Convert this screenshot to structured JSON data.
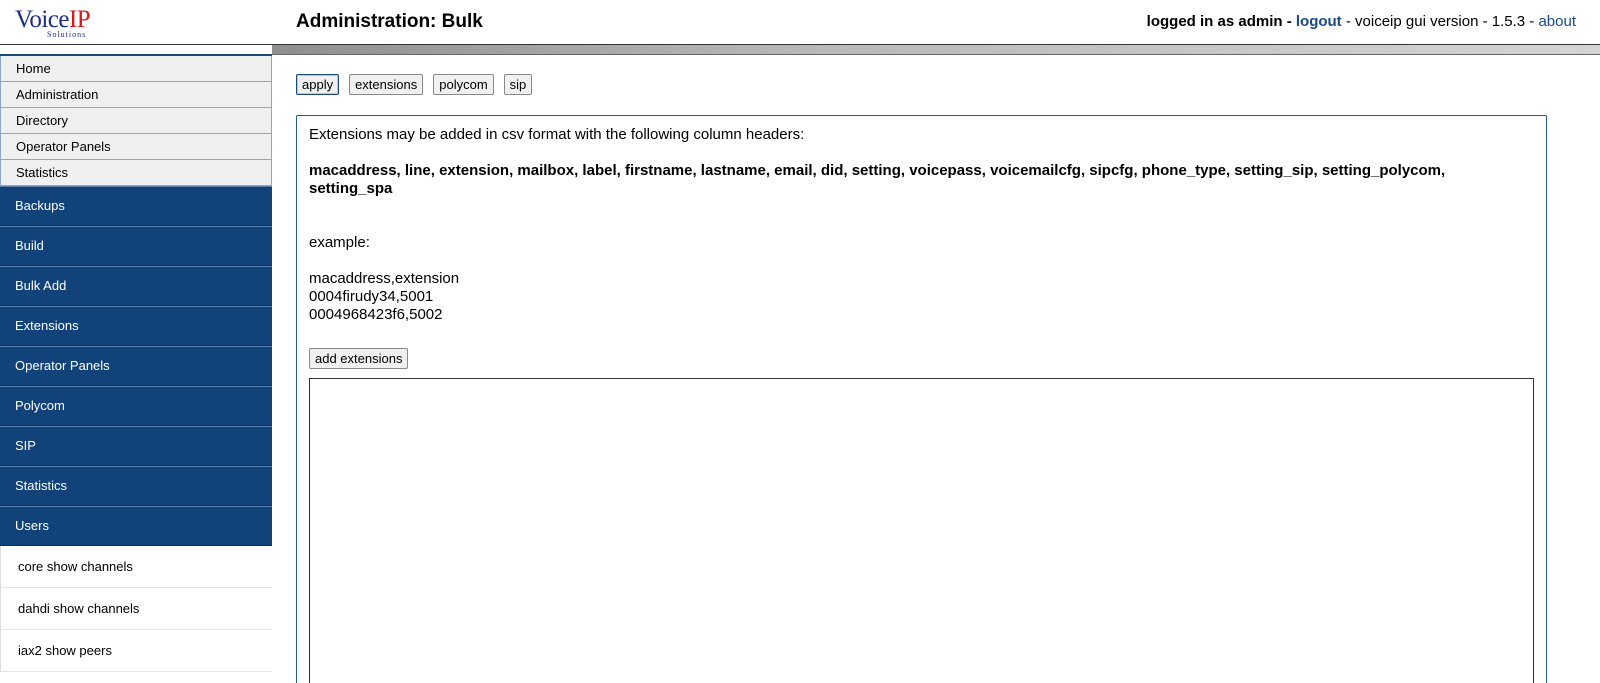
{
  "header": {
    "logo_text_main": "Voice",
    "logo_text_accent": "IP",
    "logo_subtext": "Solutions",
    "page_title": "Administration: Bulk",
    "logged_in_label": "logged in as admin -",
    "logout_link": "logout",
    "version_text": "- voiceip gui version - 1.5.3 -",
    "about_link": "about"
  },
  "sidebar": {
    "top_items": [
      {
        "label": "Home"
      },
      {
        "label": "Administration"
      },
      {
        "label": "Directory"
      },
      {
        "label": "Operator Panels"
      },
      {
        "label": "Statistics"
      }
    ],
    "admin_items": [
      {
        "label": "Backups"
      },
      {
        "label": "Build"
      },
      {
        "label": "Bulk Add"
      },
      {
        "label": "Extensions"
      },
      {
        "label": "Operator Panels"
      },
      {
        "label": "Polycom"
      },
      {
        "label": "SIP"
      },
      {
        "label": "Statistics"
      },
      {
        "label": "Users"
      }
    ],
    "command_items": [
      {
        "label": "core show channels"
      },
      {
        "label": "dahdi show channels"
      },
      {
        "label": "iax2 show peers"
      }
    ]
  },
  "toolbar": {
    "apply_label": "apply",
    "extensions_label": "extensions",
    "polycom_label": "polycom",
    "sip_label": "sip"
  },
  "panel": {
    "intro": "Extensions may be added in csv format with the following column headers:",
    "columns": "macaddress, line, extension, mailbox, label, firstname, lastname, email, did, setting, voicepass, voicemailcfg, sipcfg, phone_type, setting_sip, setting_polycom, setting_spa",
    "example_label": "example:",
    "example_lines": [
      "macaddress,extension",
      "0004firudy34,5001",
      "0004968423f6,5002"
    ],
    "add_button_label": "add extensions",
    "csv_value": ""
  },
  "colors": {
    "nav_blue": "#12427a",
    "link_blue": "#1a4a8a",
    "logo_blue": "#1d2e8a",
    "logo_red": "#c81e1e"
  }
}
